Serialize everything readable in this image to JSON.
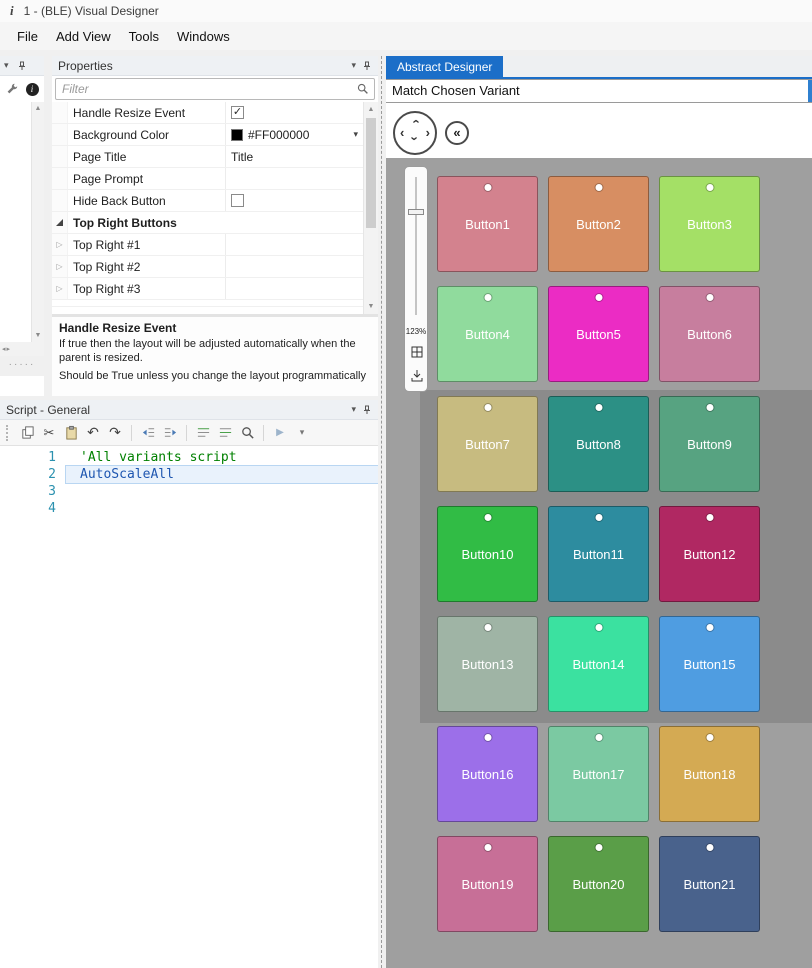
{
  "window": {
    "title": "1 - (BLE) Visual Designer"
  },
  "menu": {
    "items": [
      "File",
      "Add View",
      "Tools",
      "Windows"
    ]
  },
  "properties": {
    "title": "Properties",
    "filter_placeholder": "Filter",
    "rows": [
      {
        "kind": "checkbox",
        "name": "Handle Resize Event",
        "checked": true
      },
      {
        "kind": "color",
        "name": "Background Color",
        "value": "#FF000000",
        "swatch": "#000000"
      },
      {
        "kind": "text",
        "name": "Page Title",
        "value": "Title"
      },
      {
        "kind": "text",
        "name": "Page Prompt",
        "value": ""
      },
      {
        "kind": "checkbox",
        "name": "Hide Back Button",
        "checked": false
      },
      {
        "kind": "category",
        "name": "Top Right Buttons"
      },
      {
        "kind": "group",
        "name": "Top Right #1"
      },
      {
        "kind": "group",
        "name": "Top Right #2"
      },
      {
        "kind": "group",
        "name": "Top Right #3"
      }
    ],
    "description_title": "Handle Resize Event",
    "description_body_1": "If true then the layout will be adjusted automatically when the parent is resized.",
    "description_body_2": "Should be True unless you change the layout programmatically"
  },
  "script": {
    "title": "Script - General",
    "toolbar": [
      "copy",
      "cut",
      "paste",
      "undo",
      "redo",
      "|",
      "outdent",
      "indent",
      "|",
      "comment",
      "uncomment",
      "search",
      "|",
      "run",
      "more"
    ],
    "lines": [
      {
        "num": "1",
        "text": "'All variants script",
        "kind": "comment",
        "current": false
      },
      {
        "num": "2",
        "text": "AutoScaleAll",
        "kind": "identifier",
        "current": true
      },
      {
        "num": "3",
        "text": "",
        "kind": "plain",
        "current": false
      },
      {
        "num": "4",
        "text": "",
        "kind": "plain",
        "current": false
      }
    ]
  },
  "designer": {
    "tab_label": "Abstract Designer",
    "variant_label": "Match Chosen Variant",
    "zoom_label": "123%",
    "buttons": [
      {
        "label": "Button1",
        "color": "#d3828e"
      },
      {
        "label": "Button2",
        "color": "#d78e62"
      },
      {
        "label": "Button3",
        "color": "#a4e066"
      },
      {
        "label": "Button4",
        "color": "#90db9d"
      },
      {
        "label": "Button5",
        "color": "#eb2cc4"
      },
      {
        "label": "Button6",
        "color": "#c77e9e"
      },
      {
        "label": "Button7",
        "color": "#c7bb80"
      },
      {
        "label": "Button8",
        "color": "#2c9085"
      },
      {
        "label": "Button9",
        "color": "#57a381"
      },
      {
        "label": "Button10",
        "color": "#31bc45"
      },
      {
        "label": "Button11",
        "color": "#2d8c9f"
      },
      {
        "label": "Button12",
        "color": "#b02862"
      },
      {
        "label": "Button13",
        "color": "#9fb4a5"
      },
      {
        "label": "Button14",
        "color": "#3be1a0"
      },
      {
        "label": "Button15",
        "color": "#4f9de1"
      },
      {
        "label": "Button16",
        "color": "#9c6fe9"
      },
      {
        "label": "Button17",
        "color": "#7bc9a2"
      },
      {
        "label": "Button18",
        "color": "#d4aa53"
      },
      {
        "label": "Button19",
        "color": "#c76f97"
      },
      {
        "label": "Button20",
        "color": "#5a9e48"
      },
      {
        "label": "Button21",
        "color": "#49628c"
      }
    ]
  },
  "colors": {
    "accent_tab": "#1b6ec8",
    "canvas": "#9f9f9f",
    "canvas_dark": "#8b8b8b",
    "comment": "#008000",
    "identifier": "#1e56b0",
    "line_number": "#2b91af"
  }
}
